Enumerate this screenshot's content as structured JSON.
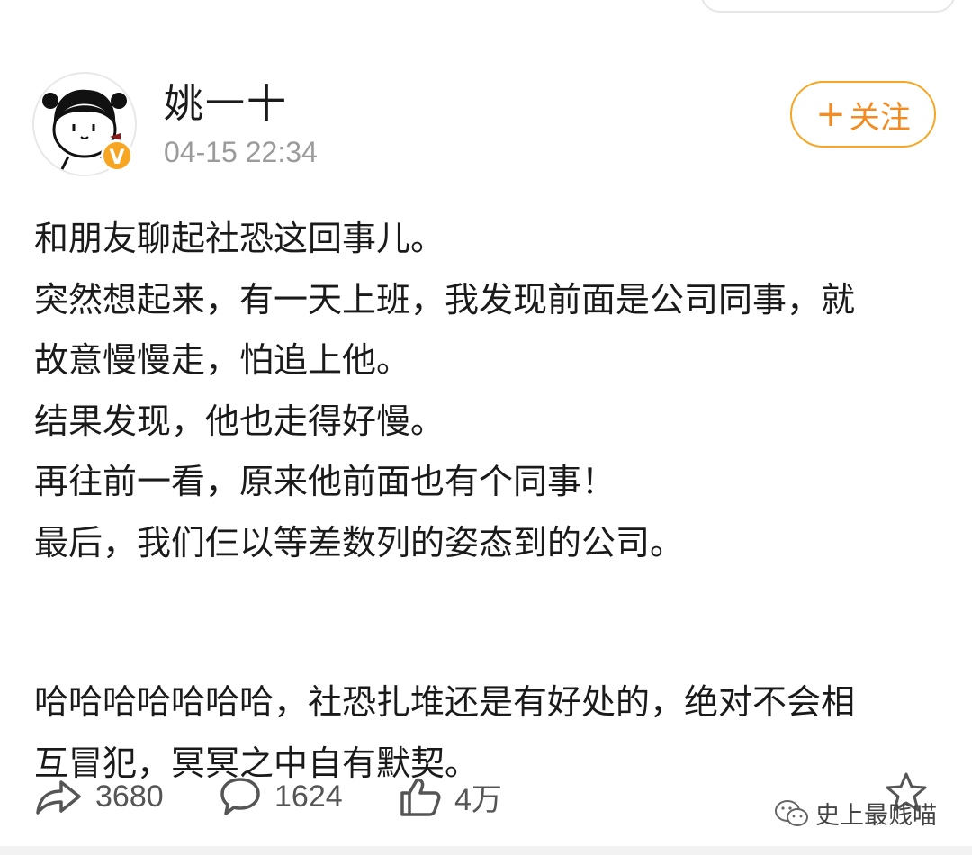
{
  "post": {
    "username": "姚一十",
    "time": "04-15 22:34",
    "verified_badge": "V",
    "follow_label": "关注",
    "follow_plus": "+",
    "lines": [
      "和朋友聊起社恐这回事儿。",
      "突然想起来，有一天上班，我发现前面是公司同事，就",
      "故意慢慢走，怕追上他。",
      "结果发现，他也走得好慢。",
      "再往前一看，原来他前面也有个同事！",
      "最后，我们仨以等差数列的姿态到的公司。",
      "",
      "哈哈哈哈哈哈哈，社恐扎堆还是有好处的，绝对不会相",
      "互冒犯，冥冥之中自有默契。"
    ]
  },
  "actions": {
    "repost": {
      "icon": "share-icon",
      "count": "3680"
    },
    "comment": {
      "icon": "comment-icon",
      "count": "1624"
    },
    "like": {
      "icon": "thumbs-up-icon",
      "count": "4万"
    },
    "favorite": {
      "icon": "star-icon"
    }
  },
  "watermark": {
    "icon": "wechat-icon",
    "text": "史上最贱喵"
  },
  "colors": {
    "accent": "#f38b21",
    "muted": "#9b9b9b",
    "text": "#1a1a1a"
  }
}
